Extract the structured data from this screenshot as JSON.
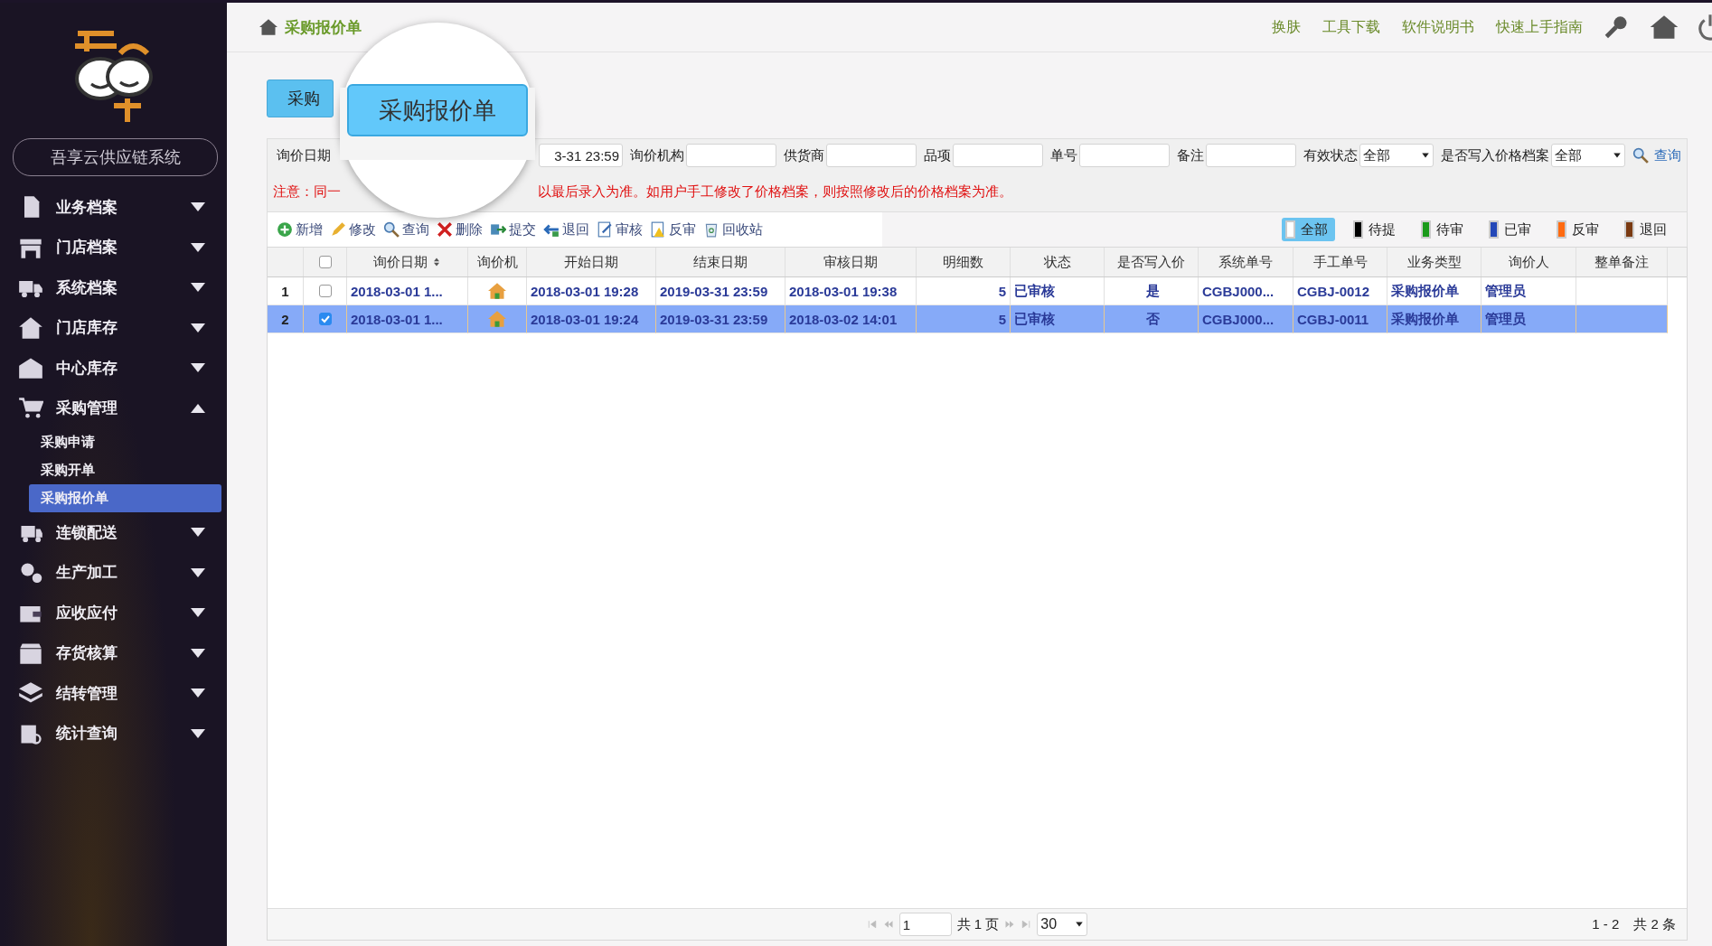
{
  "sidebar": {
    "system_name": "吾享云供应链系统",
    "menu": [
      {
        "label": "业务档案",
        "expanded": false
      },
      {
        "label": "门店档案",
        "expanded": false
      },
      {
        "label": "系统档案",
        "expanded": false
      },
      {
        "label": "门店库存",
        "expanded": false
      },
      {
        "label": "中心库存",
        "expanded": false
      },
      {
        "label": "采购管理",
        "expanded": true,
        "children": [
          {
            "label": "采购申请",
            "selected": false
          },
          {
            "label": "采购开单",
            "selected": false
          },
          {
            "label": "采购报价单",
            "selected": true
          }
        ]
      },
      {
        "label": "连锁配送",
        "expanded": false
      },
      {
        "label": "生产加工",
        "expanded": false
      },
      {
        "label": "应收应付",
        "expanded": false
      },
      {
        "label": "存货核算",
        "expanded": false
      },
      {
        "label": "结转管理",
        "expanded": false
      },
      {
        "label": "统计查询",
        "expanded": false
      }
    ]
  },
  "header": {
    "breadcrumb": "采购报价单",
    "links": [
      "换肤",
      "工具下载",
      "软件说明书",
      "快速上手指南"
    ]
  },
  "tabs": [
    {
      "label": "采购",
      "selected": true
    }
  ],
  "magnifier": {
    "label": "采购报价单"
  },
  "filters": [
    {
      "kind": "input",
      "label": "询价日期",
      "value": "3-31 23:59"
    },
    {
      "kind": "input",
      "label": "询价机构"
    },
    {
      "kind": "input",
      "label": "供货商"
    },
    {
      "kind": "input",
      "label": "品项"
    },
    {
      "kind": "input",
      "label": "单号"
    },
    {
      "kind": "input",
      "label": "备注"
    },
    {
      "kind": "select",
      "label": "有效状态",
      "value": "全部"
    },
    {
      "kind": "select",
      "label": "是否写入价格档案",
      "value": "全部"
    }
  ],
  "search_button": "查询",
  "notice": [
    "注意：同一",
    "以最后录入为准。如用户手工修改了价格档案，则按照修改后的价格档案为准。"
  ],
  "toolbar": [
    "新增",
    "修改",
    "查询",
    "删除",
    "提交",
    "退回",
    "审核",
    "反审",
    "回收站"
  ],
  "status_legend": [
    {
      "label": "全部",
      "color": "#ffffff",
      "selected": true
    },
    {
      "label": "待提",
      "color": "#000000",
      "selected": false
    },
    {
      "label": "待审",
      "color": "#1a9a1a",
      "selected": false
    },
    {
      "label": "已审",
      "color": "#2448b8",
      "selected": false
    },
    {
      "label": "反审",
      "color": "#ff6a10",
      "selected": false
    },
    {
      "label": "退回",
      "color": "#7a3a12",
      "selected": false
    }
  ],
  "table": {
    "header_checked": false,
    "columns": [
      {
        "label": "询价日期",
        "sorted": true
      },
      {
        "label": "询价机",
        "sorted": false
      },
      {
        "label": "开始日期",
        "sorted": false
      },
      {
        "label": "结束日期",
        "sorted": false
      },
      {
        "label": "审核日期",
        "sorted": false
      },
      {
        "label": "明细数",
        "sorted": false
      },
      {
        "label": "状态",
        "sorted": false
      },
      {
        "label": "是否写入价",
        "sorted": false
      },
      {
        "label": "系统单号",
        "sorted": false
      },
      {
        "label": "手工单号",
        "sorted": false
      },
      {
        "label": "业务类型",
        "sorted": false
      },
      {
        "label": "询价人",
        "sorted": false
      },
      {
        "label": "整单备注",
        "sorted": false
      }
    ],
    "rows": [
      {
        "number": "1",
        "checked": false,
        "selected": false,
        "cells": [
          "2018-03-01 1...",
          "",
          "2018-03-01 19:28",
          "2019-03-31 23:59",
          "2018-03-01 19:38",
          "5",
          "已审核",
          "是",
          "CGBJ000...",
          "CGBJ-0012",
          "采购报价单",
          "管理员",
          ""
        ]
      },
      {
        "number": "2",
        "checked": true,
        "selected": true,
        "cells": [
          "2018-03-01 1...",
          "",
          "2018-03-01 19:24",
          "2019-03-31 23:59",
          "2018-03-02 14:01",
          "5",
          "已审核",
          "否",
          "CGBJ000...",
          "CGBJ-0011",
          "采购报价单",
          "管理员",
          ""
        ]
      }
    ]
  },
  "pagination": {
    "page": "1",
    "total_pages": "共 1 页",
    "page_size": "30",
    "range": "1 - 2",
    "total": "共 2 条"
  }
}
